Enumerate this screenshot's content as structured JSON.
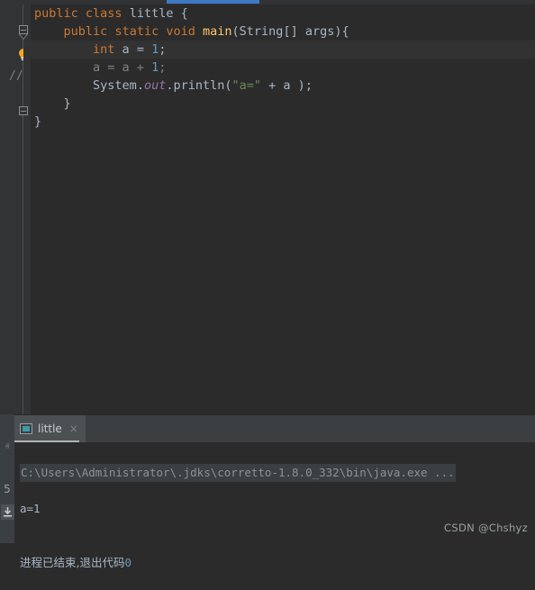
{
  "window": {
    "accent_color": "#3c79c4",
    "editor_bg": "#2b2b2b",
    "panel_bg": "#3c3f41"
  },
  "editor": {
    "gutter": {
      "intention_bulb_icon": "lightbulb-icon",
      "fold_open_icon": "fold-arrow-icon",
      "fold_close_icon": "fold-end-icon",
      "comment_marker": "//"
    },
    "lines": [
      {
        "id": 1,
        "current": false,
        "tokens": [
          {
            "t": "public",
            "c": "kw"
          },
          {
            "t": " ",
            "c": "pun"
          },
          {
            "t": "class",
            "c": "kw"
          },
          {
            "t": " ",
            "c": "pun"
          },
          {
            "t": "little",
            "c": "cls"
          },
          {
            "t": " ",
            "c": "pun"
          },
          {
            "t": "{",
            "c": "pun"
          }
        ]
      },
      {
        "id": 2,
        "current": false,
        "tokens": [
          {
            "t": "    ",
            "c": "pun"
          },
          {
            "t": "public",
            "c": "kw"
          },
          {
            "t": " ",
            "c": "pun"
          },
          {
            "t": "static",
            "c": "kw"
          },
          {
            "t": " ",
            "c": "pun"
          },
          {
            "t": "void",
            "c": "kw"
          },
          {
            "t": " ",
            "c": "pun"
          },
          {
            "t": "main",
            "c": "fn"
          },
          {
            "t": "(",
            "c": "pun"
          },
          {
            "t": "String",
            "c": "cls"
          },
          {
            "t": "[] ",
            "c": "pun"
          },
          {
            "t": "args",
            "c": "cls"
          },
          {
            "t": "){",
            "c": "pun"
          }
        ]
      },
      {
        "id": 3,
        "current": true,
        "tokens": [
          {
            "t": "        ",
            "c": "pun"
          },
          {
            "t": "int",
            "c": "kw"
          },
          {
            "t": " a ",
            "c": "pun"
          },
          {
            "t": "= ",
            "c": "pun"
          },
          {
            "t": "1",
            "c": "num"
          },
          {
            "t": ";",
            "c": "pun"
          }
        ]
      },
      {
        "id": 4,
        "current": false,
        "tokens": [
          {
            "t": "        ",
            "c": "pun"
          },
          {
            "t": "a = a + ",
            "c": "dim"
          },
          {
            "t": "1",
            "c": "num"
          },
          {
            "t": ";",
            "c": "dim"
          }
        ]
      },
      {
        "id": 5,
        "current": false,
        "tokens": [
          {
            "t": "        ",
            "c": "pun"
          },
          {
            "t": "System",
            "c": "cls"
          },
          {
            "t": ".",
            "c": "pun"
          },
          {
            "t": "out",
            "c": "fld"
          },
          {
            "t": ".",
            "c": "pun"
          },
          {
            "t": "println",
            "c": "cls"
          },
          {
            "t": "(",
            "c": "pun"
          },
          {
            "t": "\"a=\"",
            "c": "str"
          },
          {
            "t": " + a );",
            "c": "pun"
          }
        ]
      },
      {
        "id": 6,
        "current": false,
        "tokens": [
          {
            "t": "    ",
            "c": "pun"
          },
          {
            "t": "}",
            "c": "pun"
          }
        ]
      },
      {
        "id": 7,
        "current": false,
        "tokens": [
          {
            "t": "}",
            "c": "pun"
          }
        ]
      }
    ]
  },
  "console": {
    "tab": {
      "label": "little",
      "icon": "run-configuration-icon",
      "close_label": "×"
    },
    "tool_strip": {
      "up_icon": "ⱏ",
      "down_icon": "ⱟ",
      "line_number": "5",
      "download_icon": "soft-wrap-icon"
    },
    "output": {
      "command": "C:\\Users\\Administrator\\.jdks\\corretto-1.8.0_332\\bin\\java.exe ...",
      "program_output": "a=1",
      "blank_line": "",
      "exit_message": "进程已结束,退出代码",
      "exit_code": "0"
    }
  },
  "watermark": {
    "text": "CSDN @Chshyz"
  }
}
